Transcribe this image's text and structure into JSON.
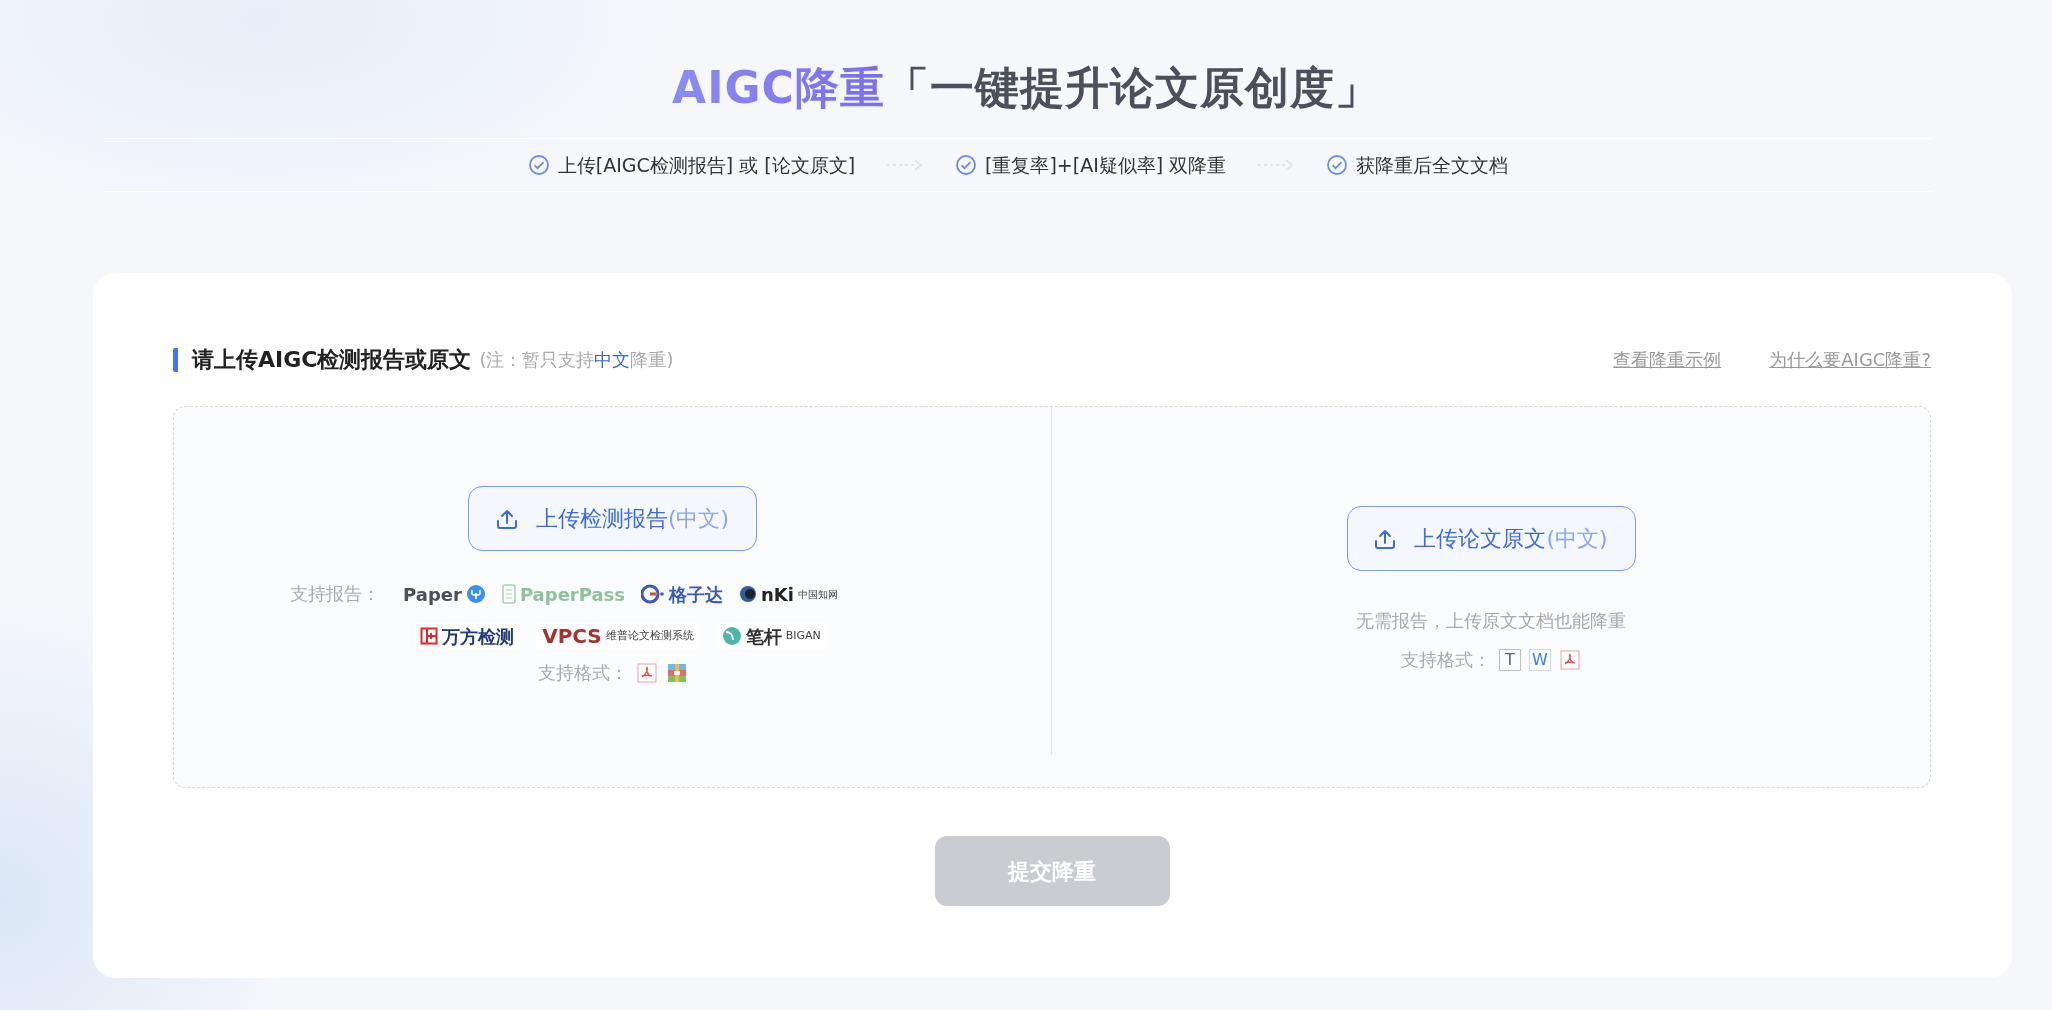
{
  "title": {
    "highlight": "AIGC降重",
    "rest": "「一键提升论文原创度」"
  },
  "steps": [
    {
      "label": "上传[AIGC检测报告] 或 [论文原文]"
    },
    {
      "label": "[重复率]+[AI疑似率] 双降重"
    },
    {
      "label": "获降重后全文文档"
    }
  ],
  "card": {
    "heading": "请上传AIGC检测报告或原文",
    "note_prefix": "(注：暂只支持",
    "note_highlight": "中文",
    "note_suffix": "降重)",
    "links": [
      "查看降重示例",
      "为什么要AIGC降重?"
    ],
    "panels": [
      {
        "button": "上传检测报告",
        "button_suffix": "(中文)",
        "reports_label": "支持报告：",
        "reports": [
          {
            "kind": "paperyy",
            "text": "Paper"
          },
          {
            "kind": "paperpass",
            "text": "PaperPass"
          },
          {
            "kind": "gezida",
            "text": "格子达"
          },
          {
            "kind": "cnki",
            "text": "nKi",
            "sub": "中国知网"
          },
          {
            "kind": "wanfang",
            "text": "万方检测"
          },
          {
            "kind": "vpcs",
            "text": "VPCS",
            "sub": "维普论文检测系统"
          },
          {
            "kind": "bigan",
            "text": "笔杆",
            "sub": "BIGAN"
          }
        ],
        "formats_label": "支持格式：",
        "formats": [
          {
            "kind": "pdf"
          },
          {
            "kind": "archive"
          }
        ]
      },
      {
        "button": "上传论文原文",
        "button_suffix": "(中文)",
        "hint": "无需报告，上传原文文档也能降重",
        "formats_label": "支持格式：",
        "formats": [
          {
            "kind": "txt",
            "letter": "T"
          },
          {
            "kind": "word",
            "letter": "W"
          },
          {
            "kind": "pdf"
          }
        ]
      }
    ],
    "submit": {
      "label": "提交降重",
      "disabled": true
    }
  }
}
